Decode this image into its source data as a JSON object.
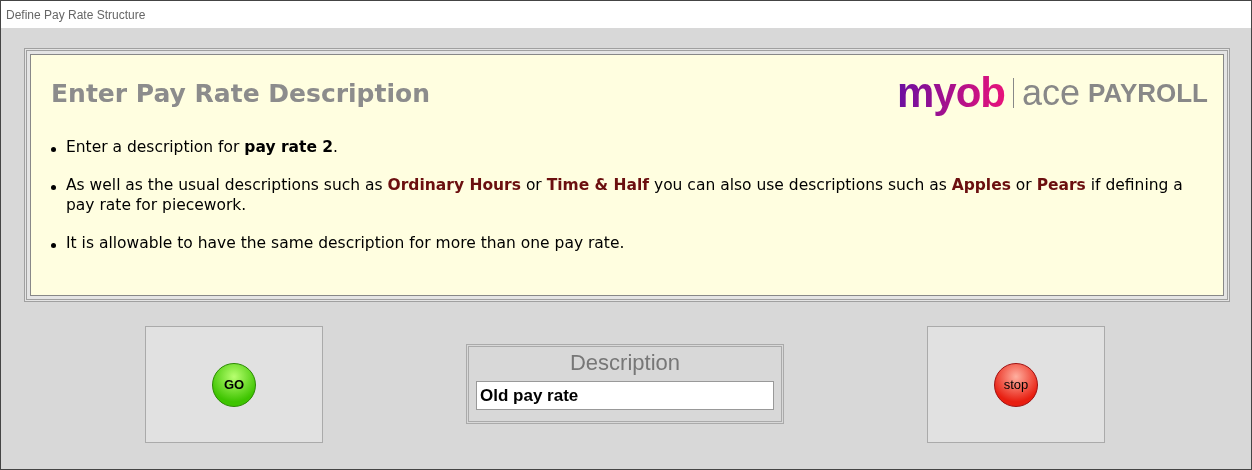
{
  "window": {
    "title": "Define Pay Rate Structure"
  },
  "panel": {
    "heading": "Enter Pay Rate Description",
    "logo": {
      "brand": "myob",
      "product": "ace",
      "suffix": "PAYROLL"
    },
    "bullets": [
      [
        {
          "text": "Enter a description for ",
          "kind": "plain"
        },
        {
          "text": "pay rate 2",
          "kind": "bold"
        },
        {
          "text": ".",
          "kind": "plain"
        }
      ],
      [
        {
          "text": "As well as the usual descriptions such as ",
          "kind": "plain"
        },
        {
          "text": "Ordinary Hours",
          "kind": "term"
        },
        {
          "text": " or ",
          "kind": "plain"
        },
        {
          "text": "Time & Half",
          "kind": "term"
        },
        {
          "text": " you can also use descriptions such as ",
          "kind": "plain"
        },
        {
          "text": "Apples",
          "kind": "term"
        },
        {
          "text": " or ",
          "kind": "plain"
        },
        {
          "text": "Pears",
          "kind": "term"
        },
        {
          "text": " if defining a pay rate for piecework.",
          "kind": "plain"
        }
      ],
      [
        {
          "text": "It is allowable to have the same description for more than one pay rate.",
          "kind": "plain"
        }
      ]
    ]
  },
  "go_button": {
    "label": "GO"
  },
  "description": {
    "label": "Description",
    "value": "Old pay rate"
  },
  "stop_button": {
    "label": "stop"
  }
}
